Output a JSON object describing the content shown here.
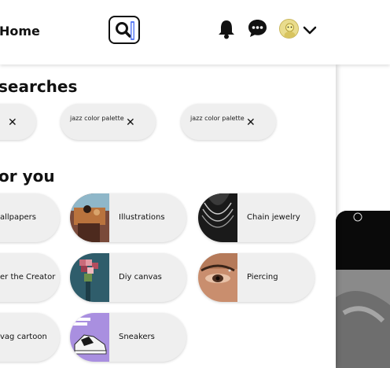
{
  "header": {
    "home_label": "Home",
    "icons": [
      "search-icon",
      "bell-icon",
      "chat-icon",
      "avatar",
      "chevron-down-icon"
    ]
  },
  "dropdown": {
    "recent_title": "searches",
    "recent": [
      {
        "label": ""
      },
      {
        "label": "jazz color palette"
      },
      {
        "label": "jazz color palette"
      }
    ],
    "ideas_title": "or you",
    "ideas": [
      {
        "label": "allpapers"
      },
      {
        "label": "Illustrations"
      },
      {
        "label": "Chain jewelry"
      },
      {
        "label": "er the Creator"
      },
      {
        "label": "Diy canvas"
      },
      {
        "label": "Piercing"
      },
      {
        "label": "vag cartoon"
      },
      {
        "label": "Sneakers"
      }
    ]
  },
  "colors": {
    "chip_bg": "#efefef",
    "panel_bg": "#ffffff",
    "text": "#111111"
  }
}
